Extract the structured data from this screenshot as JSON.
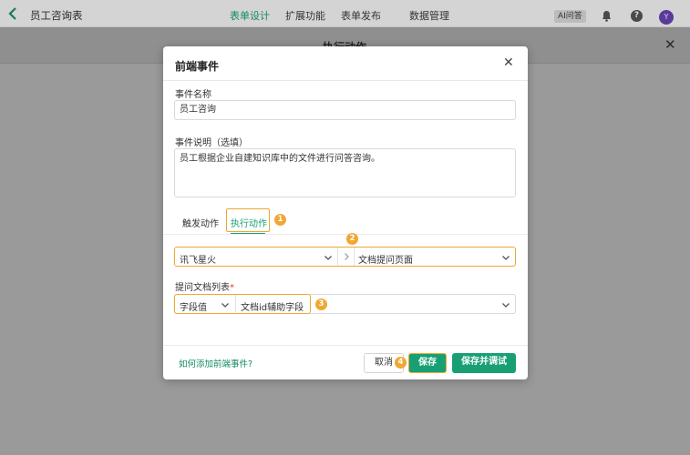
{
  "topbar": {
    "title": "员工咨询表",
    "nav": [
      "表单设计",
      "扩展功能",
      "表单发布",
      "数据管理"
    ],
    "ai_label": "AI问答",
    "help": "?",
    "avatar_letter": "Y"
  },
  "panel": {
    "title": "执行动作"
  },
  "modal": {
    "title": "前端事件",
    "name_label": "事件名称",
    "name_value": "员工咨询",
    "desc_label": "事件说明（选填）",
    "desc_value": "员工根据企业自建知识库中的文件进行问答咨询。",
    "tabs": [
      "触发动作",
      "执行动作"
    ],
    "action_provider": "讯飞星火",
    "action_type": "文档提问页面",
    "doclist_label": "提问文档列表",
    "doclist_required": "*",
    "doclist_mode": "字段值",
    "doclist_field": "文档id辅助字段",
    "help_link": "如何添加前端事件?",
    "cancel": "取消",
    "save": "保存",
    "save_debug": "保存并调试"
  },
  "annotations": [
    "1",
    "2",
    "3",
    "4"
  ],
  "colors": {
    "accent": "#18a074",
    "highlight": "#f0a733"
  }
}
